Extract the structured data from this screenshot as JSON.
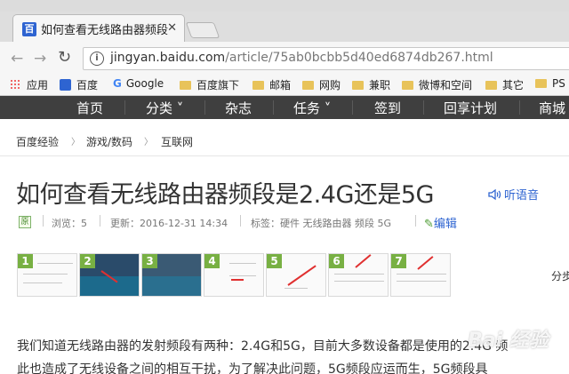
{
  "browser": {
    "tab_title": "如何查看无线路由器频段",
    "tab_favicon": "百",
    "url_host": "jingyan.baidu.com",
    "url_path": "/article/75ab0bcbb5d40ed6874db267.html",
    "bookmarks": [
      {
        "icon": "apps-icon",
        "label": "应用"
      },
      {
        "icon": "baidu-icon",
        "label": "百度"
      },
      {
        "icon": "google-icon",
        "label": "Google"
      },
      {
        "icon": "folder-icon",
        "label": "百度旗下"
      },
      {
        "icon": "folder-icon",
        "label": "邮箱"
      },
      {
        "icon": "folder-icon",
        "label": "网购"
      },
      {
        "icon": "folder-icon",
        "label": "兼职"
      },
      {
        "icon": "folder-icon",
        "label": "微博和空间"
      },
      {
        "icon": "folder-icon",
        "label": "其它"
      },
      {
        "icon": "folder-icon",
        "label": "PS"
      }
    ]
  },
  "site_nav": {
    "items": [
      {
        "label": "首页"
      },
      {
        "label": "分类 ˅"
      },
      {
        "label": "杂志"
      },
      {
        "label": "任务 ˅"
      },
      {
        "label": "签到"
      },
      {
        "label": "回享计划"
      },
      {
        "label": "商城"
      }
    ]
  },
  "breadcrumb": [
    "百度经验",
    "游戏/数码",
    "互联网"
  ],
  "article": {
    "title": "如何查看无线路由器频段是2.4G还是5G",
    "listen_label": "听语音",
    "origin_badge": "原",
    "views": "浏览：5",
    "updated": "更新：2016-12-31 14:34",
    "tags": "标签：硬件 无线路由器 频段 5G",
    "edit_label": "编辑",
    "step_numbers": [
      "1",
      "2",
      "3",
      "4",
      "5",
      "6",
      "7"
    ],
    "steps_label": "分步",
    "paragraph_line1": "我们知道无线路由器的发射频段有两种：2.4G和5G，目前大多数设备都是使用的2.4G 频",
    "paragraph_line2": "此也造成了无线设备之间的相互干扰，为了解决此问题，5G频段应运而生，5G频段具",
    "watermark": "Bai 经验"
  },
  "colors": {
    "nav_bg": "#3f3f3f",
    "link_blue": "#2e64d1",
    "step_green": "#78b043"
  }
}
